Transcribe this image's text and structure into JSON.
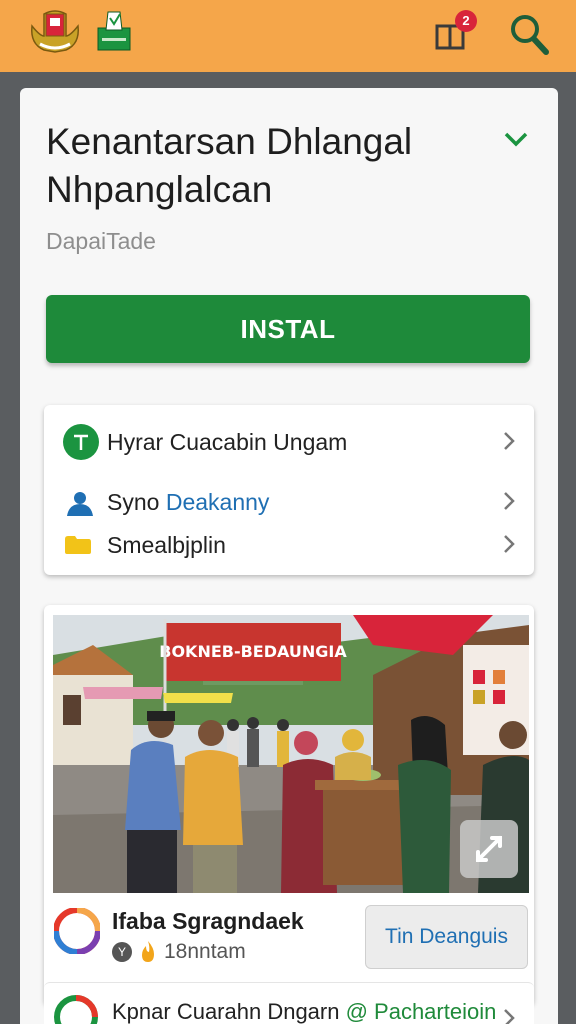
{
  "header": {
    "notification_count": "2",
    "icons": [
      "emblem-logo",
      "ballot-box-logo",
      "bag-icon",
      "search-icon"
    ]
  },
  "app": {
    "title": "Kenantarsan Dhlangal Nhpanglalcan",
    "developer": "DapaiTade",
    "install_label": "INSTAL"
  },
  "links": [
    {
      "label": "Hyrar Cuacabin Ungam",
      "icon": "text-circle-icon",
      "color": "#1b9440"
    },
    {
      "label_a": "Syno ",
      "label_b": "Deakanny",
      "icon": "person-icon",
      "color": "#1f6fb3"
    },
    {
      "label": "Smealbjplin",
      "icon": "folder-icon",
      "color": "#f2c318"
    }
  ],
  "photo": {
    "banner_text": "BOKNEB-BEDAUNGIA"
  },
  "featured": {
    "name": "Ifaba Sgragndaek",
    "meta": "18nntam",
    "badge": "Y",
    "button_label": "Tin Deanguis"
  },
  "bottom": {
    "text_a": "Kpnar Cuarahn Dngarn ",
    "text_b": "@ Pacharteioin"
  },
  "colors": {
    "topbar": "#f5a64a",
    "install": "#1e8a3a",
    "accent_green": "#1b9440",
    "accent_blue": "#1f6fb3"
  }
}
